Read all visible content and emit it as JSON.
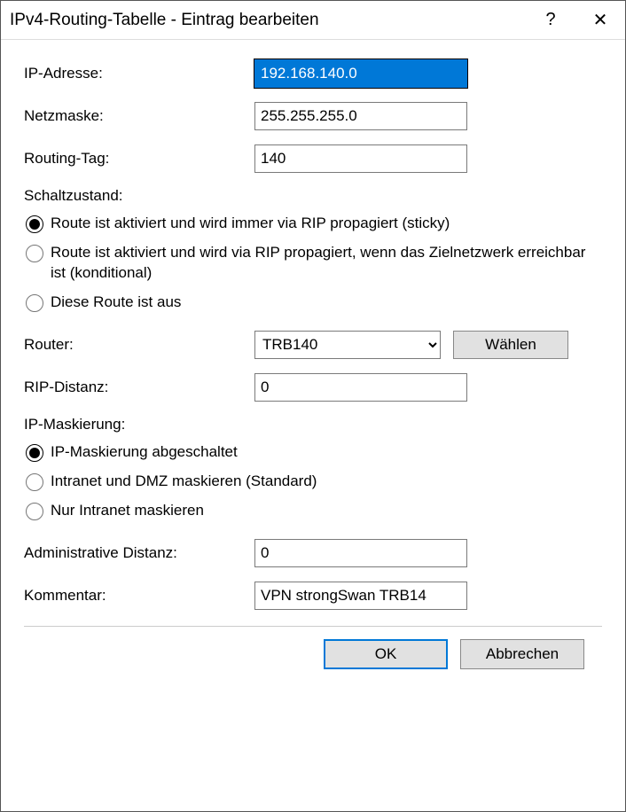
{
  "title": "IPv4-Routing-Tabelle - Eintrag bearbeiten",
  "help_symbol": "?",
  "close_symbol": "✕",
  "fields": {
    "ip_label": "IP-Adresse:",
    "ip_value": "192.168.140.0",
    "netmask_label": "Netzmaske:",
    "netmask_value": "255.255.255.0",
    "tag_label": "Routing-Tag:",
    "tag_value": "140",
    "router_label": "Router:",
    "router_value": "TRB140",
    "router_select_label": "Wählen",
    "rip_label": "RIP-Distanz:",
    "rip_value": "0",
    "admin_label": "Administrative Distanz:",
    "admin_value": "0",
    "comment_label": "Kommentar:",
    "comment_value": "VPN strongSwan TRB14"
  },
  "state": {
    "group_label": "Schaltzustand:",
    "options": [
      "Route ist aktiviert und wird immer via RIP propagiert (sticky)",
      "Route ist aktiviert und wird via RIP propagiert, wenn das Zielnetzwerk erreichbar ist (konditional)",
      "Diese Route ist aus"
    ],
    "selected": 0
  },
  "mask": {
    "group_label": "IP-Maskierung:",
    "options": [
      "IP-Maskierung abgeschaltet",
      "Intranet und DMZ maskieren (Standard)",
      "Nur Intranet maskieren"
    ],
    "selected": 0
  },
  "buttons": {
    "ok": "OK",
    "cancel": "Abbrechen"
  }
}
